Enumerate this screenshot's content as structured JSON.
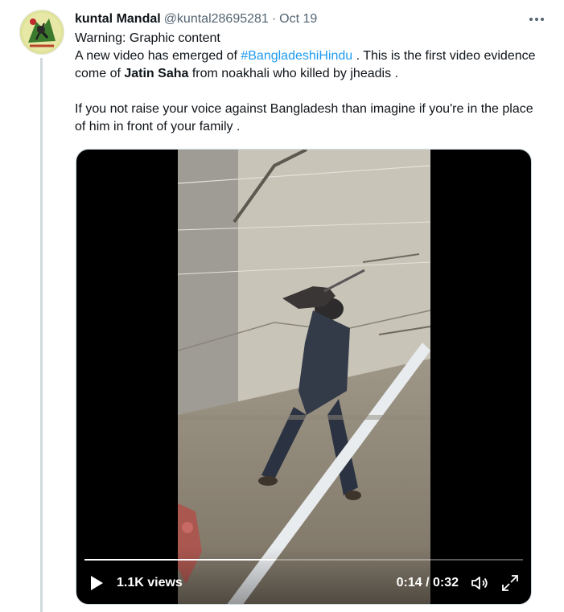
{
  "tweet": {
    "display_name": "kuntal Mandal",
    "handle": "@kuntal28695281",
    "dot": "·",
    "time": "Oct 19",
    "more_icon": "more-horizontal-icon",
    "text": {
      "line1": "Warning: Graphic content",
      "p1_before_hashtag": "A new video has emerged of ",
      "hashtag": "#BangladeshiHindu",
      "p1_after_hashtag": " . This is the first video evidence come of ",
      "bold_name": "Jatin Saha",
      "p1_end": " from noakhali who killed by jheadis .",
      "p2": "If you not raise your voice against Bangladesh than imagine if you're in the place of him in front of your family ."
    },
    "accent_color": "#1d9bf0",
    "thread_line_color": "#cfd9de"
  },
  "video": {
    "views": "1.1K views",
    "time_readout": "0:14 / 0:32",
    "progress": 0.4375,
    "play_icon": "play-icon",
    "volume_icon": "volume-icon",
    "fullscreen_icon": "fullscreen-icon"
  }
}
